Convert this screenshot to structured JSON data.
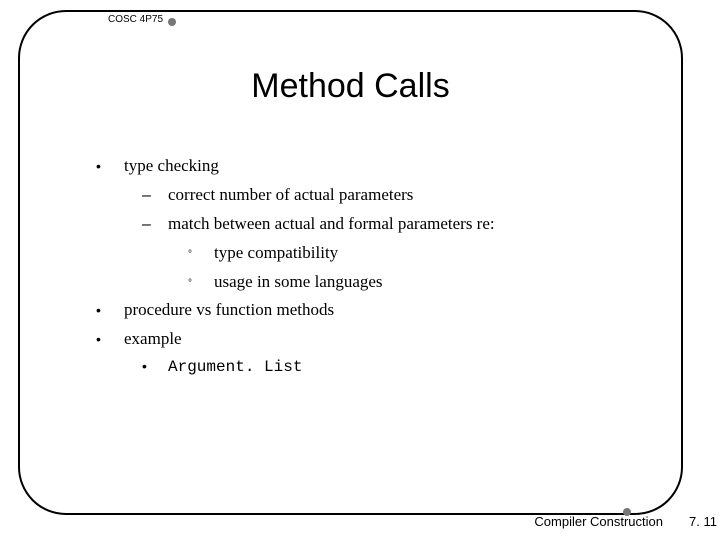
{
  "course": "COSC 4P75",
  "title": "Method Calls",
  "bullets": {
    "b1": "type checking",
    "b1_1": "correct number of actual parameters",
    "b1_2": "match between actual and formal parameters re:",
    "b1_2_1": "type compatibility",
    "b1_2_2": "usage in some languages",
    "b2": "procedure vs function methods",
    "b3": "example",
    "b3_1": "Argument. List"
  },
  "footer": "Compiler Construction",
  "page": "7. 11"
}
